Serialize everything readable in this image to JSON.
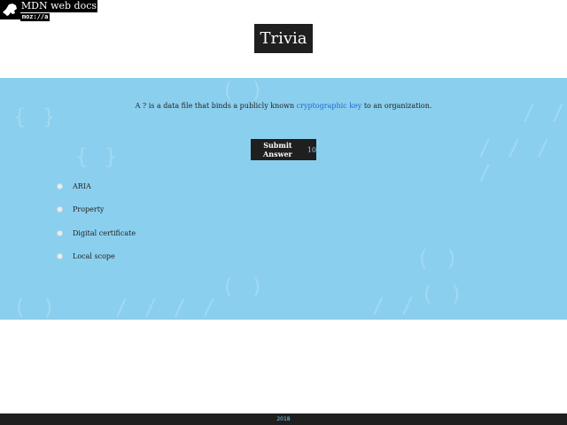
{
  "logo": {
    "title": "MDN web docs",
    "subtitle": "moz://a"
  },
  "header": {
    "title": "Trivia"
  },
  "quiz": {
    "question_before": "A ? is a data file that binds a publicly known ",
    "question_link": "cryptographic key",
    "question_after": " to an organization.",
    "submit_label": "Submit Answer",
    "submit_count": "10",
    "answers": [
      {
        "label": "ARIA"
      },
      {
        "label": "Property"
      },
      {
        "label": "Digital certificate"
      },
      {
        "label": "Local scope"
      }
    ]
  },
  "footer": {
    "year": "2018"
  },
  "colors": {
    "panel_bg": "#8bcfee",
    "dark": "#1f1f1f",
    "link": "#1a6ad4"
  },
  "icons": {
    "logo": "dinosaur-head-icon",
    "radio": "radio-button-icon"
  }
}
